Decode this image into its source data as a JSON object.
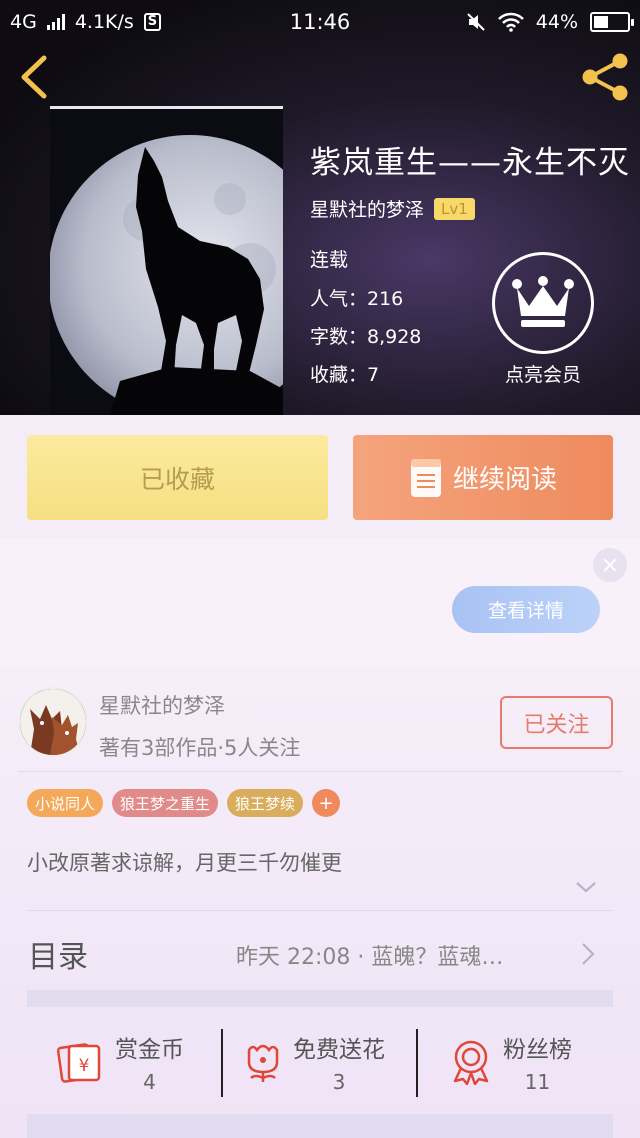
{
  "status_bar": {
    "network": "4G",
    "speed": "4.1K/s",
    "s_badge": "S",
    "time": "11:46",
    "battery": "44%",
    "battery_level": 0.44
  },
  "book": {
    "title": "紫岚重生——永生不灭",
    "author": "星默社的梦泽",
    "level": "Lv1",
    "status": "连载",
    "popularity": "人气：216",
    "words": "字数：8,928",
    "favorites": "收藏：7"
  },
  "vip": {
    "label": "点亮会员"
  },
  "actions": {
    "collected_label": "已收藏",
    "read_label": "继续阅读"
  },
  "ad": {
    "detail_label": "查看详情",
    "close_icon": "×"
  },
  "author_card": {
    "name": "星默社的梦泽",
    "works": "著有3部作品·5人关注",
    "follow_label": "已关注"
  },
  "tags": [
    {
      "label": "小说同人",
      "color": "#f3a85a"
    },
    {
      "label": "狼王梦之重生",
      "color": "#e08a8a"
    },
    {
      "label": "狼王梦续",
      "color": "#d9ad5c"
    }
  ],
  "tag_add": "+",
  "intro": "小改原著求谅解，月更三千勿催更",
  "toc": {
    "label": "目录",
    "latest": "昨天 22:08 · 蓝魄？蓝魂…"
  },
  "stats": [
    {
      "label": "赏金币",
      "value": "4",
      "icon": "red-envelope-icon"
    },
    {
      "label": "免费送花",
      "value": "3",
      "icon": "flower-icon"
    },
    {
      "label": "粉丝榜",
      "value": "11",
      "icon": "medal-icon"
    }
  ],
  "colors": {
    "accent_orange": "#ef8a5e",
    "collected_yellow": "#f6df82",
    "follow_red": "#e47c6c",
    "icon_red": "#e0473a"
  }
}
